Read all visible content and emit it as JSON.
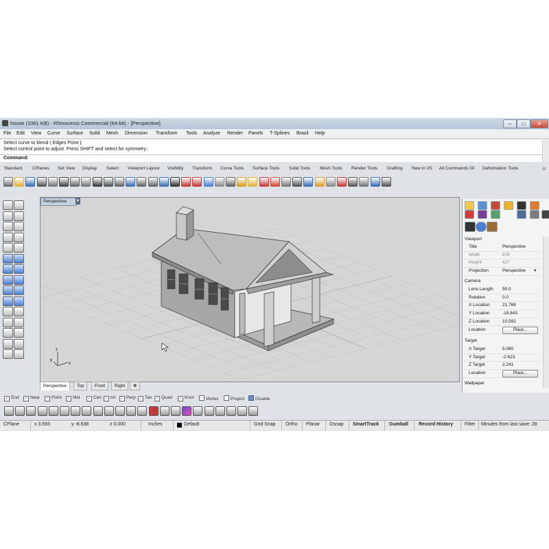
{
  "window": {
    "title": "house (1061 KB) - Rhinoceros Commercial (64-bit) - [Perspective]",
    "min": "–",
    "max": "□",
    "close": "✕"
  },
  "menu": [
    "File",
    "Edit",
    "View",
    "Curve",
    "Surface",
    "Solid",
    "Mesh",
    "Dimension",
    "Transform",
    "Tools",
    "Analyze",
    "Render",
    "Panels",
    "T-Splines",
    "Brazil",
    "Help"
  ],
  "command_history": [
    "Select curve to blend ( Edges  Point ):",
    "Select control point to adjust. Press SHIFT and select for symmetry.:"
  ],
  "command_label": "Command:",
  "toolbar_tabs": [
    "Standard",
    "CPlanes",
    "Set View",
    "Display",
    "Select",
    "Viewport Layout",
    "Visibility",
    "Transform",
    "Curve Tools",
    "Surface Tools",
    "Solid Tools",
    "Mesh Tools",
    "Render Tools",
    "Drafting",
    "New in V5",
    "All Commands 00",
    "Deformation Tools"
  ],
  "viewport": {
    "title": "Perspective",
    "dropdown": "▼",
    "axis_x": "x",
    "axis_y": "y",
    "axis_z": "z"
  },
  "viewport_tabs": [
    "Perspective",
    "Top",
    "Front",
    "Right",
    "✥"
  ],
  "osnaps": [
    {
      "label": "End",
      "checked": true
    },
    {
      "label": "Near",
      "checked": true
    },
    {
      "label": "Point",
      "checked": true
    },
    {
      "label": "Mid",
      "checked": true
    },
    {
      "label": "Cen",
      "checked": true
    },
    {
      "label": "Int",
      "checked": true
    },
    {
      "label": "Perp",
      "checked": true
    },
    {
      "label": "Tan",
      "checked": true
    },
    {
      "label": "Quad",
      "checked": true
    },
    {
      "label": "Knot",
      "checked": true
    },
    {
      "label": "Vertex",
      "checked": false
    },
    {
      "label": "Project",
      "checked": false
    },
    {
      "label": "Disable",
      "checked": false
    }
  ],
  "statusbar": {
    "cplane": "CPlane",
    "x": "x 3.593",
    "y": "y -8.638",
    "z": "z 0.000",
    "units": "Inches",
    "layer": "Default",
    "grid_snap": "Grid Snap",
    "ortho": "Ortho",
    "planar": "Planar",
    "osnap": "Osnap",
    "smarttrack": "SmartTrack",
    "gumball": "Gumball",
    "record_history": "Record History",
    "filter": "Filter",
    "last_save": "Minutes from last save: 28"
  },
  "properties": {
    "viewport_header": "Viewport",
    "viewport_rows": [
      {
        "key": "Title",
        "value": "Perspective",
        "dim": false
      },
      {
        "key": "Width",
        "value": "976",
        "dim": true
      },
      {
        "key": "Height",
        "value": "427",
        "dim": true
      },
      {
        "key": "Projection",
        "value": "Perspective",
        "dim": false,
        "dropdown": true
      }
    ],
    "camera_header": "Camera",
    "camera_rows": [
      {
        "key": "Lens Length",
        "value": "50.0"
      },
      {
        "key": "Rotation",
        "value": "0.0"
      },
      {
        "key": "X Location",
        "value": "21.768"
      },
      {
        "key": "Y Location",
        "value": "-19.843"
      },
      {
        "key": "Z Location",
        "value": "10.592"
      }
    ],
    "camera_location_key": "Location",
    "camera_place": "Place...",
    "target_header": "Target",
    "target_rows": [
      {
        "key": "X Target",
        "value": "5.080"
      },
      {
        "key": "Y Target",
        "value": "-2.623"
      },
      {
        "key": "Z Target",
        "value": "2.241"
      }
    ],
    "target_location_key": "Location",
    "target_place": "Place...",
    "wallpaper_header": "Wallpaper"
  },
  "colors": {
    "titlebar": "#b7c6d8",
    "viewport_bg": "#d5d5d5",
    "grid": "#bdbdbd",
    "house_wall": "#9c9c9c",
    "roof": "#c2c2c2"
  }
}
